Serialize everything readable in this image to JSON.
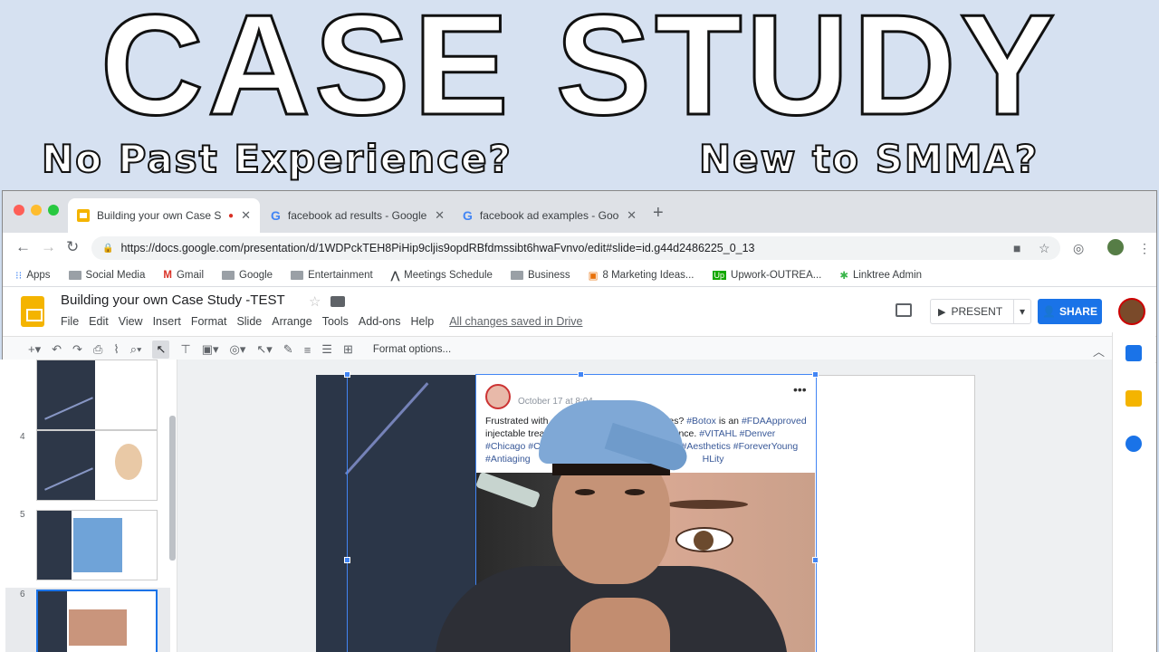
{
  "banner": {
    "title": "CASE STUDY",
    "subtitle_left": "No Past Experience?",
    "subtitle_right": "New to SMMA?"
  },
  "browser": {
    "tabs": [
      {
        "label": "Building your own Case Stu",
        "active": true,
        "icon": "slides-icon"
      },
      {
        "label": "facebook ad results - Google S",
        "active": false,
        "icon": "google-icon"
      },
      {
        "label": "facebook ad examples - Googl",
        "active": false,
        "icon": "google-icon"
      }
    ],
    "url": "https://docs.google.com/presentation/d/1WDPckTEH8PiHip9cljis9opdRBfdmssibt6hwaFvnvo/edit#slide=id.g44d2486225_0_13",
    "bookmarks": [
      {
        "label": "Apps",
        "icon": "apps-grid-icon"
      },
      {
        "label": "Social Media",
        "icon": "folder-icon"
      },
      {
        "label": "Gmail",
        "icon": "gmail-icon"
      },
      {
        "label": "Google",
        "icon": "folder-icon"
      },
      {
        "label": "Entertainment",
        "icon": "folder-icon"
      },
      {
        "label": "Meetings Schedule",
        "icon": "meetings-icon"
      },
      {
        "label": "Business",
        "icon": "folder-icon"
      },
      {
        "label": "8 Marketing Ideas...",
        "icon": "bookmark-icon"
      },
      {
        "label": "Upwork-OUTREA...",
        "icon": "upwork-icon"
      },
      {
        "label": "Linktree Admin",
        "icon": "linktree-icon"
      }
    ]
  },
  "app": {
    "doc_title": "Building your own Case Study -TEST",
    "menu": [
      "File",
      "Edit",
      "View",
      "Insert",
      "Format",
      "Slide",
      "Arrange",
      "Tools",
      "Add-ons",
      "Help"
    ],
    "saved_status": "All changes saved in Drive",
    "present_label": "PRESENT",
    "share_label": "SHARE",
    "format_options": "Format options..."
  },
  "filmstrip": {
    "slide_numbers": [
      "4",
      "5",
      "6"
    ]
  },
  "post": {
    "date": "October 17 at 8:04",
    "text_a": "Frustrated with ",
    "text_b": "es? ",
    "tag_botox": "#Botox",
    "text_c": " is an ",
    "tag_fda": "#FDAApproved",
    "line2_a": "injectable treat",
    "line2_b": "arance. ",
    "tag_vital": "#VITAHL",
    "tag_denver": "#Denver",
    "tag_chicago": "#Chicago",
    "tag_ch": "#Ch",
    "tag_aesthetics": "#Aesthetics",
    "tag_forever": "#ForeverYoung",
    "tag_antiaging": "#Antiaging",
    "tag_hlity": "HLity"
  },
  "colors": {
    "banner_bg": "#d6e1f1",
    "share_blue": "#1a73e8",
    "slides_yellow": "#f4b400",
    "slide_navy": "#2b3648"
  }
}
